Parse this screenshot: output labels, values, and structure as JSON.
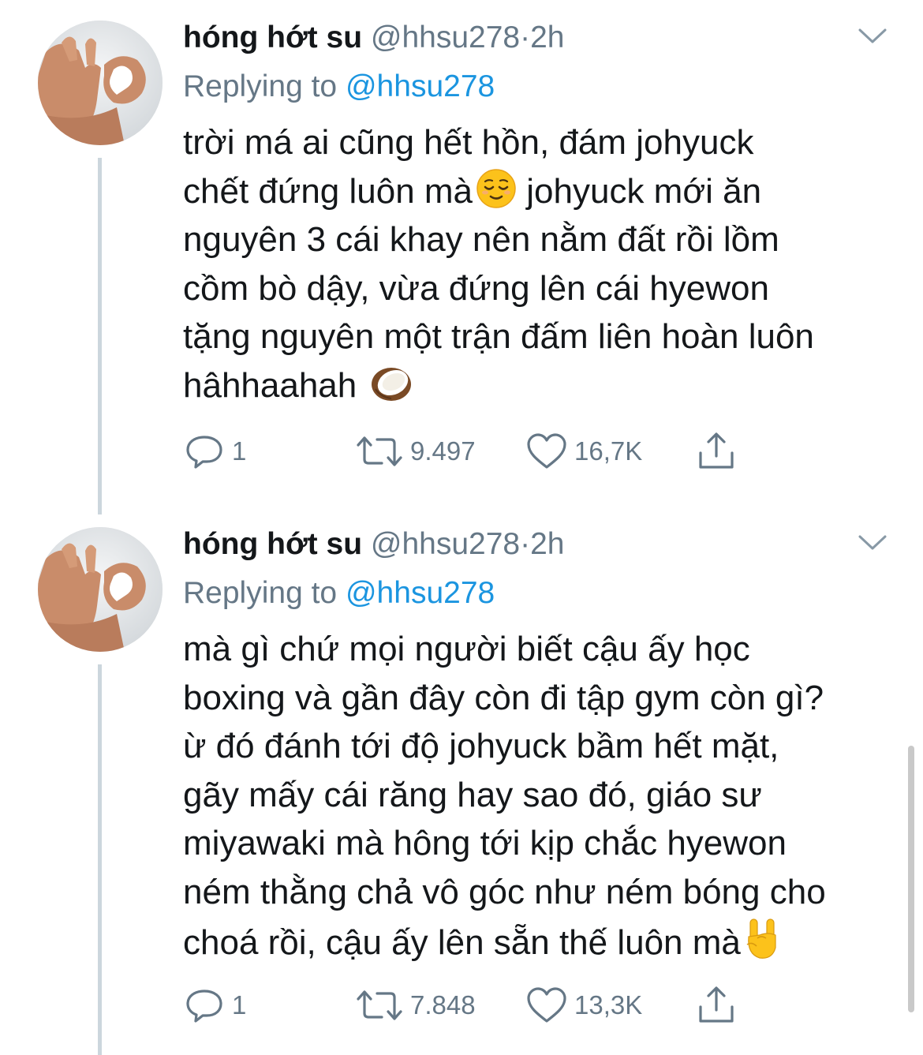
{
  "tweets": [
    {
      "name": "hóng hớt su",
      "handle": "@hhsu278",
      "separator": "·",
      "time": "2h",
      "replying_prefix": "Replying to",
      "replying_to": "@hhsu278",
      "lines": [
        "trời má ai cũng hết hồn, đám johyuck",
        "chết đứng luôn mà",
        "johyuck mới ăn",
        "nguyên 3 cái khay nên nằm đất rồi lồm",
        "cồm bò dậy, vừa đứng lên cái hyewon",
        "tặng nguyên một trận đấm liên hoàn luôn",
        "hâhhaahah"
      ],
      "emojis": [
        "relieved-face-emoji",
        "coconut-emoji"
      ],
      "replies": "1",
      "retweets": "9.497",
      "likes": "16,7K"
    },
    {
      "name": "hóng hớt su",
      "handle": "@hhsu278",
      "separator": "·",
      "time": "2h",
      "replying_prefix": "Replying to",
      "replying_to": "@hhsu278",
      "lines": [
        "mà gì chứ mọi người biết cậu ấy học",
        "boxing và gần đây còn đi tập gym còn gì?",
        "ừ đó đánh tới độ johyuck bầm hết mặt,",
        "gãy mấy cái răng hay sao đó, giáo sư",
        "miyawaki mà hông tới kịp chắc hyewon",
        "ném thằng chả vô góc như ném bóng cho",
        "choá rồi, cậu ấy lên sẵn thế luôn mà"
      ],
      "emojis": [
        "rock-on-hand-emoji"
      ],
      "replies": "1",
      "retweets": "7.848",
      "likes": "13,3K"
    }
  ],
  "colors": {
    "text": "#14171a",
    "secondary": "#657786",
    "link": "#1b95e0",
    "thread_line": "#ccd6dd"
  },
  "icons": [
    "reply-icon",
    "retweet-icon",
    "like-icon",
    "share-icon",
    "chevron-down-icon"
  ]
}
